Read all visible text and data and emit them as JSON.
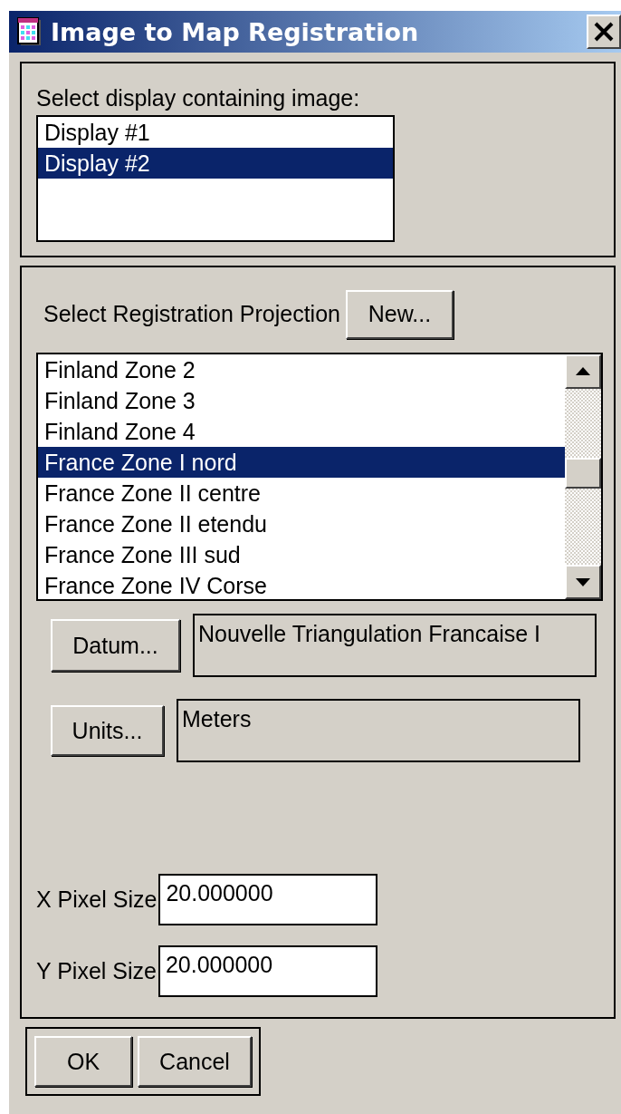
{
  "window": {
    "title": "Image to Map Registration"
  },
  "display_section": {
    "label": "Select display containing image:",
    "items": [
      {
        "label": "Display #1",
        "selected": false
      },
      {
        "label": "Display #2",
        "selected": true
      }
    ]
  },
  "projection_section": {
    "label": "Select Registration Projection",
    "new_button": "New...",
    "items": [
      {
        "label": "Finland Zone 2",
        "selected": false
      },
      {
        "label": "Finland Zone 3",
        "selected": false
      },
      {
        "label": "Finland Zone 4",
        "selected": false
      },
      {
        "label": "France Zone I nord",
        "selected": true
      },
      {
        "label": "France Zone II centre",
        "selected": false
      },
      {
        "label": "France Zone II etendu",
        "selected": false
      },
      {
        "label": "France Zone III sud",
        "selected": false
      },
      {
        "label": "France Zone IV Corse",
        "selected": false
      }
    ],
    "datum": {
      "button": "Datum...",
      "value": "Nouvelle Triangulation Francaise I"
    },
    "units": {
      "button": "Units...",
      "value": "Meters"
    },
    "x_pixel_size": {
      "label": "X Pixel Size",
      "value": "20.000000"
    },
    "y_pixel_size": {
      "label": "Y Pixel Size",
      "value": "20.000000"
    }
  },
  "buttons": [
    {
      "label": "OK"
    },
    {
      "label": "Cancel"
    }
  ]
}
